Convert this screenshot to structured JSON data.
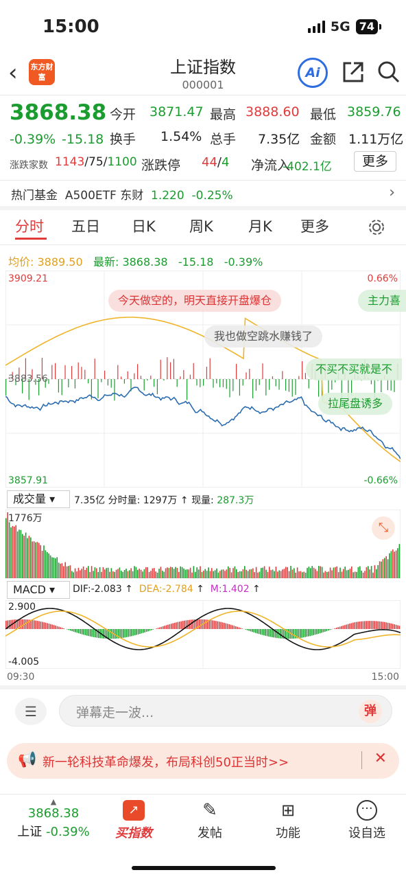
{
  "status": {
    "time": "15:00",
    "network": "5G",
    "battery": "74"
  },
  "header": {
    "logo_text": "东方财富",
    "title": "上证指数",
    "code": "000001",
    "ai_label": "Ai"
  },
  "quote": {
    "price": "3868.38",
    "change_pct": "-0.39%",
    "change": "-15.18",
    "open_label": "今开",
    "open": "3871.47",
    "high_label": "最高",
    "high": "3888.60",
    "low_label": "最低",
    "low": "3859.76",
    "turnover_label": "换手",
    "turnover": "1.54%",
    "volume_label": "总手",
    "volume": "7.35亿",
    "amount_label": "金额",
    "amount": "1.11万亿",
    "breadth_label": "涨跌家数",
    "up": "1143",
    "flat": "75",
    "down": "1100",
    "limit_label": "涨跌停",
    "limit_up": "44",
    "limit_down": "4",
    "netflow_label": "净流入",
    "netflow": "-402.1亿",
    "more_label": "更多"
  },
  "fund": {
    "label": "热门基金",
    "name": "A500ETF 东财",
    "price": "1.220",
    "change": "-0.25%"
  },
  "tabs": [
    "分时",
    "五日",
    "日K",
    "周K",
    "月K",
    "更多"
  ],
  "intraday": {
    "avg_label": "均价:",
    "avg": "3889.50",
    "latest_label": "最新:",
    "latest": "3868.38",
    "chg": "-15.18",
    "chg_pct": "-0.39%",
    "y_max": "3909.21",
    "y_mid": "3883.56",
    "y_min": "3857.91",
    "pct_max": "0.66%",
    "pct_min": "-0.66%"
  },
  "danmaku": [
    "今天做空的，明天直接开盘爆仓",
    "主力喜",
    "我也做空跳水赚钱了",
    "不买不买就是不",
    "拉尾盘诱多"
  ],
  "volume_panel": {
    "label": "成交量",
    "total": "7.35亿",
    "tick_label": "分时量: 1297万",
    "now_label": "现量:",
    "now": "287.3万",
    "y_max": "1776万"
  },
  "macd_panel": {
    "label": "MACD",
    "dif": "DIF:-2.083",
    "dea": "DEA:-2.784",
    "m": "M:1.402",
    "y_max": "2.900",
    "y_min": "-4.005",
    "t_start": "09:30",
    "t_end": "15:00"
  },
  "comment": {
    "placeholder": "弹幕走一波...",
    "send": "弹"
  },
  "banner": {
    "text": "新一轮科技革命爆发，布局科创50正当时>>"
  },
  "bottom_nav": {
    "index_price": "3868.38",
    "index_name": "上证",
    "index_pct": "-0.39%",
    "items": [
      "买指数",
      "发帖",
      "功能",
      "设自选"
    ]
  },
  "colors": {
    "up": "#e03a3a",
    "down": "#1a9c2e",
    "avg_line": "#f0b429",
    "price_line": "#2b6cb0",
    "accent": "#f05a22"
  }
}
